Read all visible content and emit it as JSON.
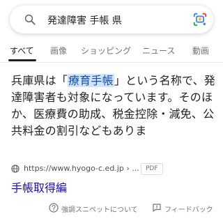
{
  "search": {
    "query": "発達障害 手帳 県"
  },
  "tabs": [
    {
      "label": "すべて",
      "active": true
    },
    {
      "label": "画像"
    },
    {
      "label": "ショッピング"
    },
    {
      "label": "ニュース"
    },
    {
      "label": "動画"
    }
  ],
  "snippet": {
    "before": "兵庫県は「",
    "highlight": "療育手帳",
    "after": "」という名称で、発達障害者も対象になっています。そのほか、医療費の助成、税金控除・減免、公共料金の割引などもありま"
  },
  "result": {
    "url": "https://www.hyogo-c.ed.jp › ...",
    "badge": "PDF",
    "title": "手帳取得編"
  },
  "footer": {
    "about": "強調スニペットについて",
    "feedback": "フィードバック"
  },
  "colors": {
    "link": "#1a0dab",
    "highlight_bg": "#d2e3fc",
    "highlight_text": "#174ea6"
  }
}
